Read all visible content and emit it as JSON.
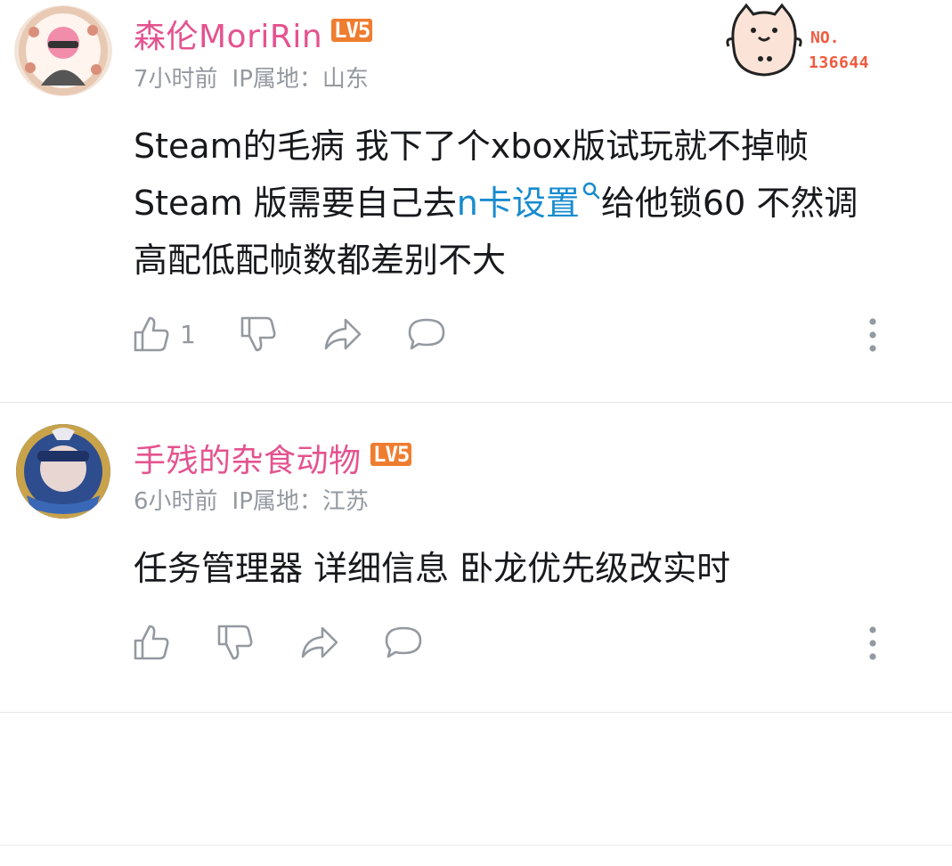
{
  "comments": [
    {
      "username": "森伦MoriRin",
      "level": "LV5",
      "time": "7小时前",
      "ip_location": "IP属地：山东",
      "content_lines": [
        [
          "Steam的毛病 我下了个xbox版试玩就不掉帧"
        ],
        [
          "Steam 版需要自己去",
          "n卡设置",
          "给他锁60 不然调"
        ],
        [
          "高配低配帧数都差别不大"
        ]
      ],
      "likes": "1",
      "fan_badge": {
        "label": "NO.",
        "number": "136644"
      }
    },
    {
      "username": "手残的杂食动物",
      "level": "LV5",
      "time": "6小时前",
      "ip_location": "IP属地：江苏",
      "content_lines": [
        [
          "任务管理器 详细信息 卧龙优先级改实时"
        ]
      ],
      "likes": ""
    }
  ],
  "colors": {
    "username": "#e4538f",
    "level_badge": "#ef7d30",
    "link": "#178bcf",
    "meta": "#9499a0"
  },
  "icons": [
    "thumb-up-icon",
    "thumb-down-icon",
    "share-icon",
    "reply-icon",
    "more-icon",
    "search-icon"
  ]
}
